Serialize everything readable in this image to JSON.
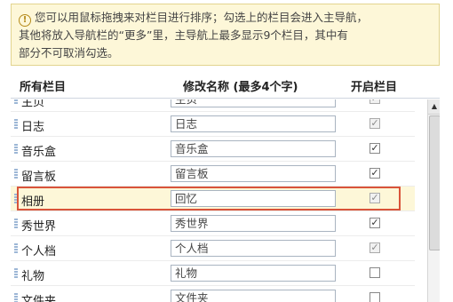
{
  "notice": {
    "icon": "info-circle-icon",
    "lines": [
      "您可以用鼠标拖拽来对栏目进行排序；勾选上的栏目会进入主导航，",
      "其他将放入导航栏的“更多”里，主导航上最多显示9个栏目，其中有",
      "部分不可取消勾选。"
    ]
  },
  "table": {
    "headers": {
      "name": "所有栏目",
      "rename": "修改名称 (最多4个字)",
      "enable": "开启栏目"
    },
    "rows": [
      {
        "name": "主页",
        "value": "主页",
        "checked": true,
        "disabled": true
      },
      {
        "name": "日志",
        "value": "日志",
        "checked": true,
        "disabled": true
      },
      {
        "name": "音乐盒",
        "value": "音乐盒",
        "checked": true,
        "disabled": false
      },
      {
        "name": "留言板",
        "value": "留言板",
        "checked": true,
        "disabled": false
      },
      {
        "name": "相册",
        "value": "回忆",
        "checked": true,
        "disabled": true,
        "highlighted": true
      },
      {
        "name": "秀世界",
        "value": "秀世界",
        "checked": true,
        "disabled": false
      },
      {
        "name": "个人档",
        "value": "个人档",
        "checked": true,
        "disabled": true
      },
      {
        "name": "礼物",
        "value": "礼物",
        "checked": false,
        "disabled": false
      },
      {
        "name": "文件夹",
        "value": "文件夹",
        "checked": false,
        "disabled": false
      }
    ]
  },
  "colors": {
    "highlight_border": "#d9543a",
    "notice_bg": "#fdf7d8"
  }
}
